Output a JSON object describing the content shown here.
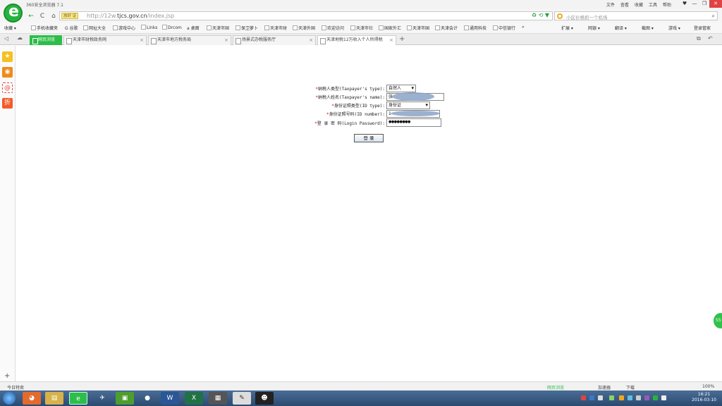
{
  "app": {
    "title": "360安全浏览器 7.1",
    "menu": [
      "文件",
      "查看",
      "收藏",
      "工具",
      "帮助"
    ],
    "window_controls": [
      "♥",
      "—",
      "❐",
      "✕"
    ]
  },
  "nav": {
    "back": "←",
    "refresh": "C",
    "home": "⌂",
    "trust_badge": "放好 证",
    "url_prefix": "http://12w.",
    "url_domain": "tjcs.gov.cn",
    "url_path": "/index.jsp",
    "url_icons": "♻ ⟲ ▼",
    "search_placeholder": "小区价格抓一个机场",
    "search_icon": "⌕"
  },
  "bookmarks": [
    "收藏 ▾",
    "手机收藏夹",
    "G 谷歌",
    "网址大全",
    "游戏中心",
    "Links",
    "Drcom",
    "a 桌面",
    "天津市国",
    "保卫萝卜",
    "天津市财",
    "天津外国",
    "欢迎访问",
    "天津市社",
    "国家外汇",
    "天津市国",
    "天津会计",
    "通用科技",
    "中信银行",
    "»"
  ],
  "bookmarks_right": [
    "扩展 ▾",
    "网银 ▾",
    "翻译 ▾",
    "截图 ▾",
    "游戏 ▾",
    "登录管家"
  ],
  "tabs": [
    {
      "label": "网页浏览",
      "kind": "green"
    },
    {
      "label": "天津市财税政务网",
      "kind": "normal"
    },
    {
      "label": "天津市地方税务局",
      "kind": "normal"
    },
    {
      "label": "场景式办税服务厅",
      "kind": "normal"
    },
    {
      "label": "天津地税12万收入个人所得税",
      "kind": "active"
    }
  ],
  "tab_new": "+",
  "tab_close": "×",
  "form": {
    "required_mark": "*",
    "fields": [
      {
        "label": "纳税人类型(Taxpayer's type):",
        "value": "自然人",
        "type": "select"
      },
      {
        "label": "纳税人姓名(Taxpayer's name):",
        "value": "张",
        "type": "text"
      },
      {
        "label": "身份证照类型(ID type):",
        "value": "身份证",
        "type": "select"
      },
      {
        "label": "身份证照号码(ID number):",
        "value": "1",
        "type": "text"
      },
      {
        "label": "登 录 密 码(Login Password):",
        "value": "●●●●●●●●",
        "type": "password"
      }
    ],
    "login_button": "登  录"
  },
  "float_badge": "55",
  "status": {
    "left": "今日特卖",
    "right": [
      "网页浏览",
      "加速器",
      "下载",
      "100%"
    ]
  },
  "taskbar": {
    "time": "16:21",
    "date": "2016-03-10"
  },
  "colors": {
    "accent": "#2ebd4a",
    "required": "#e00000",
    "taskbar": "#2b4a70"
  }
}
